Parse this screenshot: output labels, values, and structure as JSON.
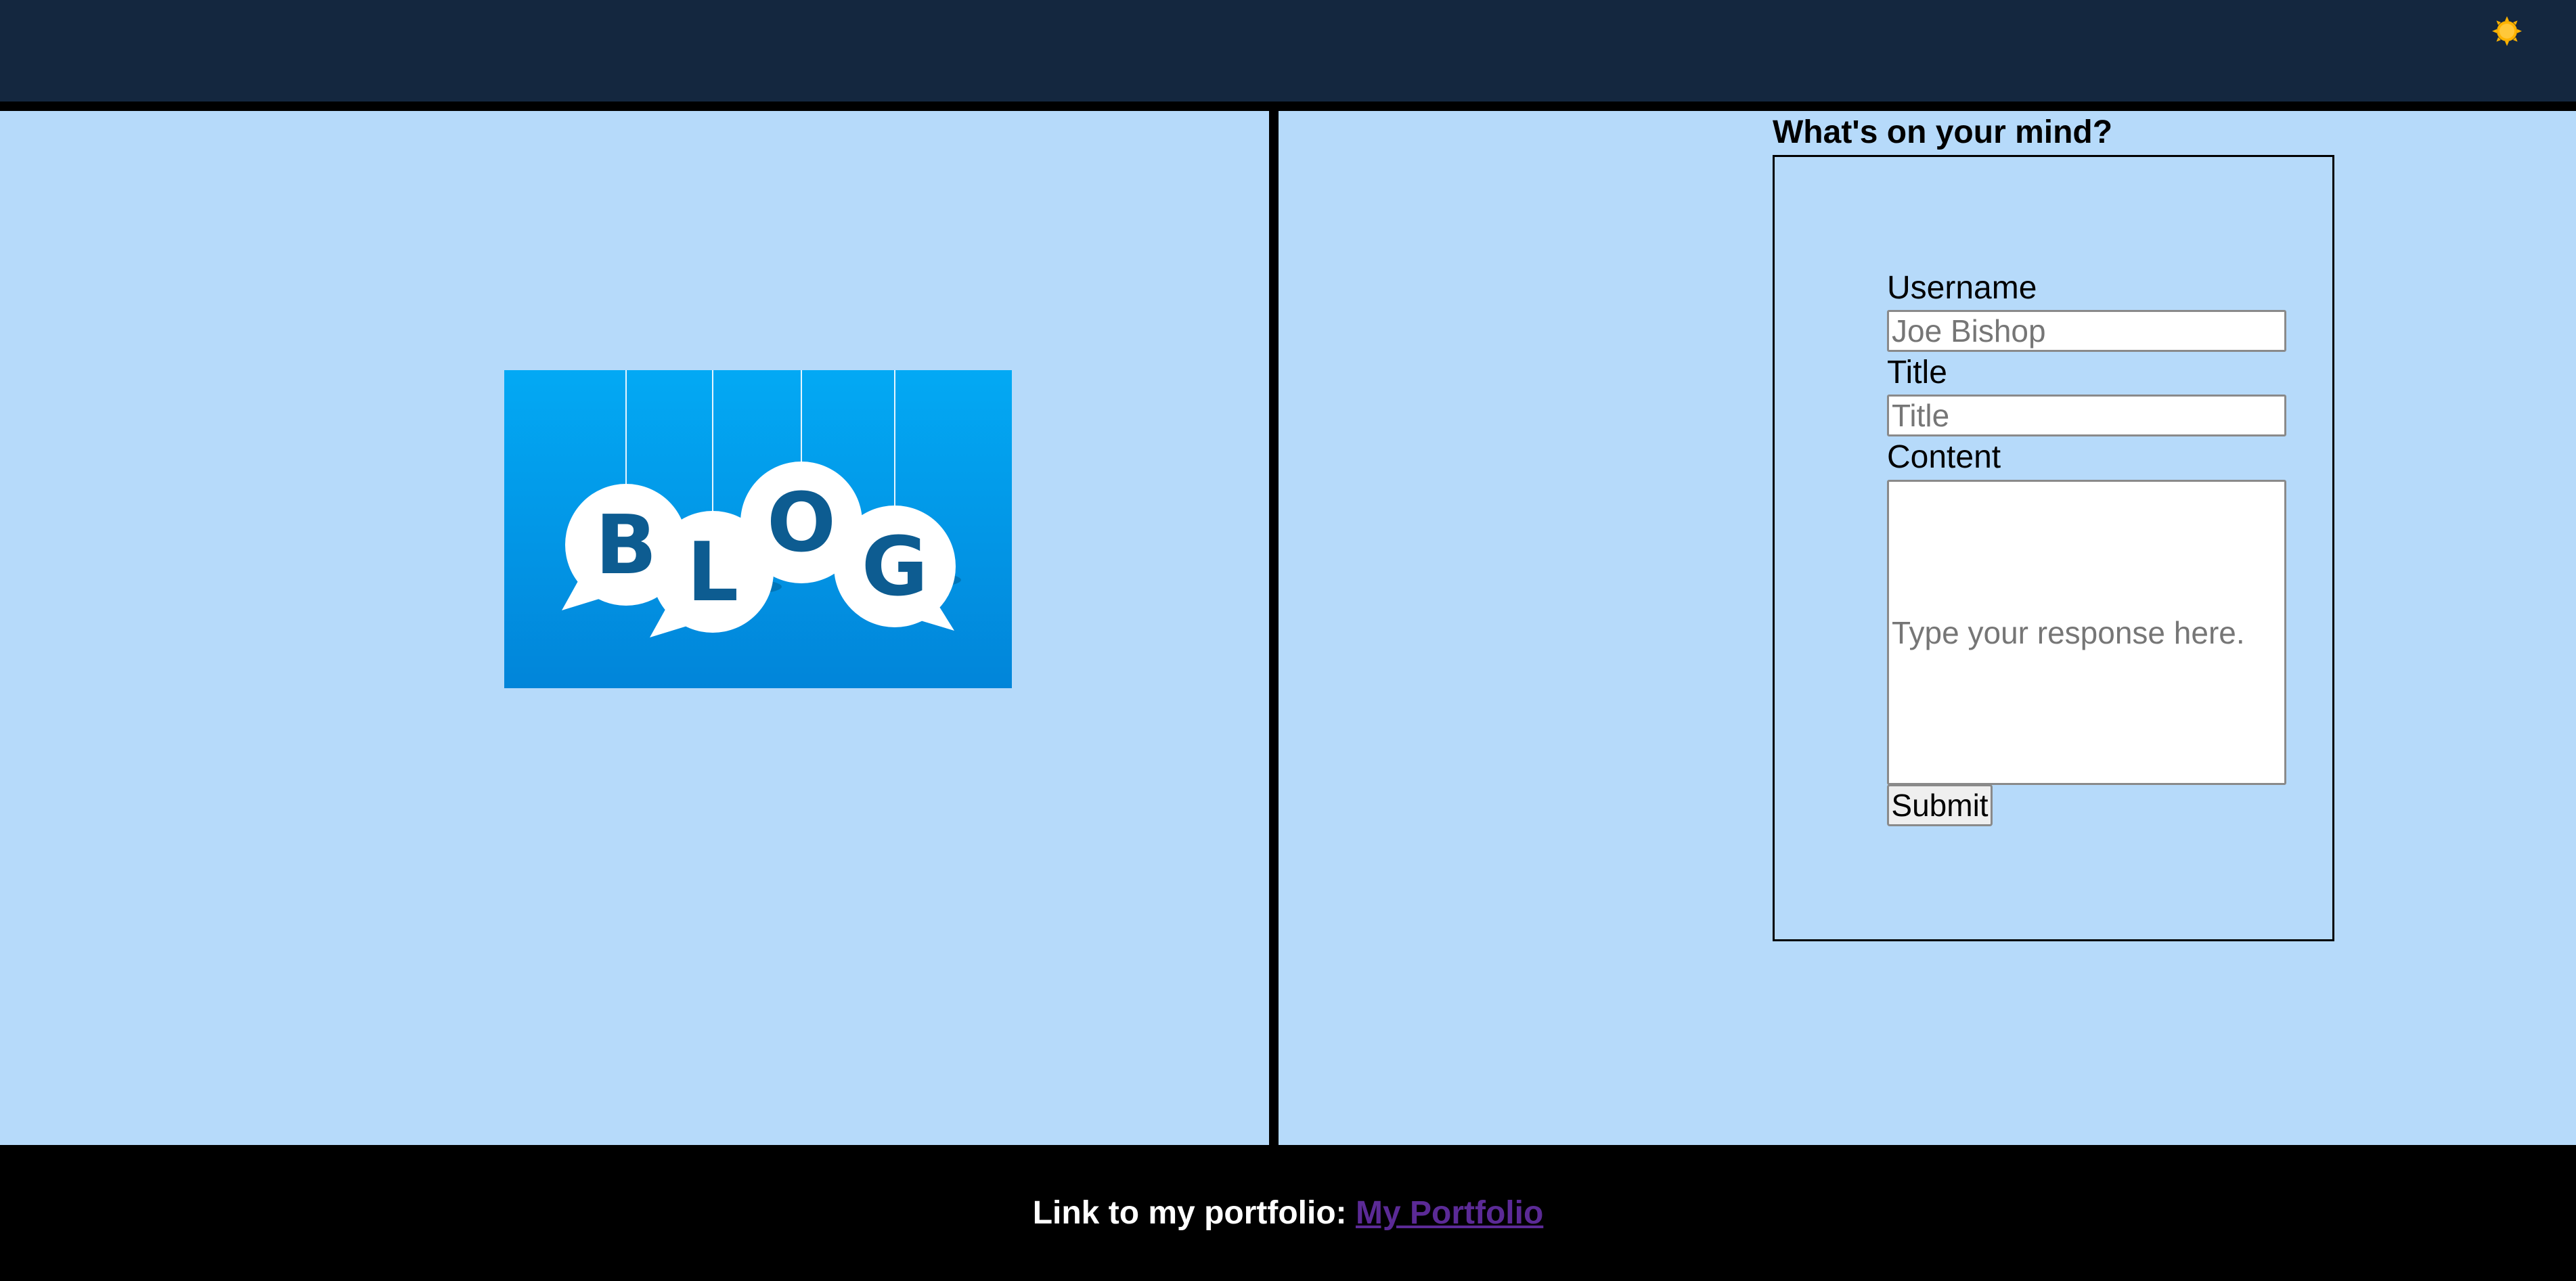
{
  "header": {
    "theme_toggle_icon": "sun-icon"
  },
  "hero": {
    "image_letters": [
      "B",
      "L",
      "O",
      "G"
    ],
    "image_colors": {
      "background_top": "#03a9f4",
      "background_bottom": "#0185d9",
      "bubble": "#ffffff",
      "letter": "#0d5c91"
    }
  },
  "form": {
    "heading": "What's on your mind?",
    "username_label": "Username",
    "username_placeholder": "Joe Bishop",
    "title_label": "Title",
    "title_placeholder": "Title",
    "content_label": "Content",
    "content_placeholder": "Type your response here.",
    "submit_label": "Submit"
  },
  "footer": {
    "text": "Link to my portfolio: ",
    "link_label": "My Portfolio"
  },
  "colors": {
    "header_bg": "#14273f",
    "panel_bg": "#b6dafa",
    "divider": "#000000",
    "footer_bg": "#000000",
    "link": "#5b2a96",
    "sun": "#ffb300"
  }
}
